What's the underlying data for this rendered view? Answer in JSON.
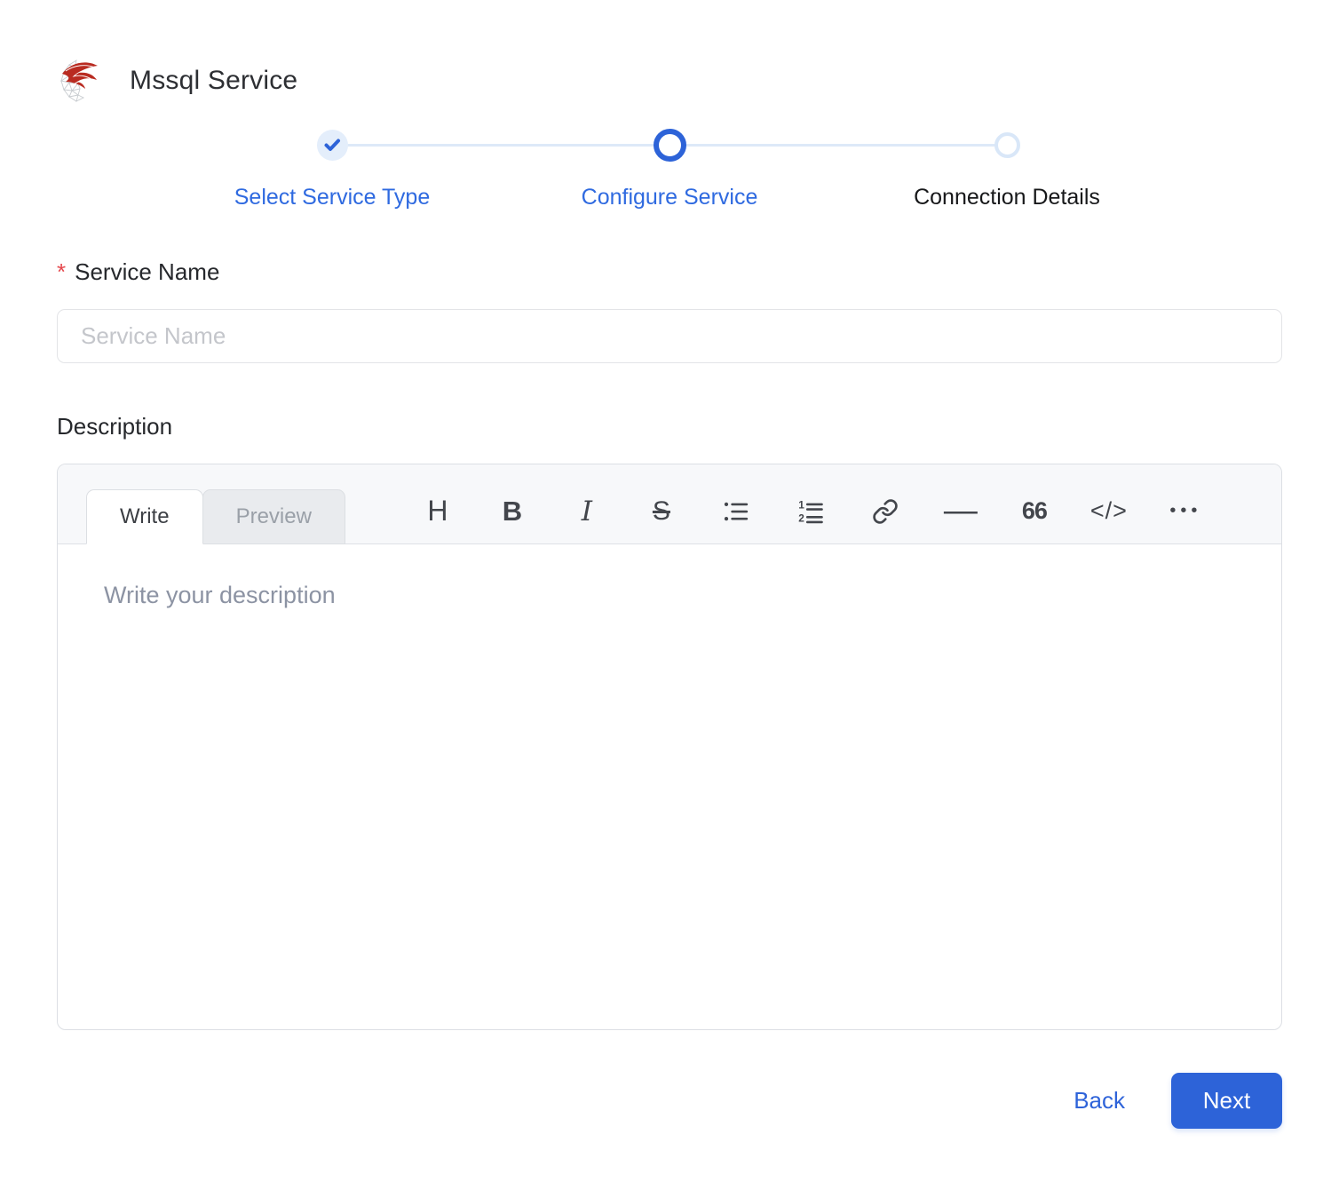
{
  "header": {
    "title": "Mssql Service",
    "logo_icon": "mssql-server-logo"
  },
  "stepper": {
    "steps": [
      {
        "label": "Select Service Type",
        "state": "completed",
        "icon": "check-icon"
      },
      {
        "label": "Configure Service",
        "state": "active",
        "icon": "ring-icon"
      },
      {
        "label": "Connection Details",
        "state": "upcoming",
        "icon": "ring-icon"
      }
    ]
  },
  "form": {
    "service_name": {
      "required_marker": "*",
      "label": "Service Name",
      "placeholder": "Service Name",
      "value": ""
    },
    "description": {
      "label": "Description",
      "placeholder": "Write your description",
      "value": ""
    }
  },
  "editor": {
    "tabs": [
      {
        "label": "Write",
        "active": true
      },
      {
        "label": "Preview",
        "active": false
      }
    ],
    "toolbar": [
      {
        "name": "heading-icon",
        "glyph": "H"
      },
      {
        "name": "bold-icon",
        "glyph": "B"
      },
      {
        "name": "italic-icon",
        "glyph": "I"
      },
      {
        "name": "strikethrough-icon",
        "glyph": "S"
      },
      {
        "name": "unordered-list-icon",
        "glyph": ""
      },
      {
        "name": "ordered-list-icon",
        "glyph": ""
      },
      {
        "name": "link-icon",
        "glyph": ""
      },
      {
        "name": "horizontal-rule-icon",
        "glyph": "—"
      },
      {
        "name": "quote-icon",
        "glyph": "66"
      },
      {
        "name": "code-icon",
        "glyph": "</>"
      },
      {
        "name": "more-icon",
        "glyph": "•••"
      }
    ]
  },
  "actions": {
    "back_label": "Back",
    "next_label": "Next"
  },
  "colors": {
    "accent_blue": "#2d63d8",
    "step_label_blue": "#2f6ae0",
    "light_blue_fill": "#e4eefb",
    "light_blue_line": "#dde9f8",
    "required_red": "#e5484d",
    "editor_header_bg": "#f7f8fa",
    "border_gray": "#dcdfe4",
    "placeholder_gray": "#c4c6cb",
    "editor_placeholder_gray": "#8c93a3"
  }
}
